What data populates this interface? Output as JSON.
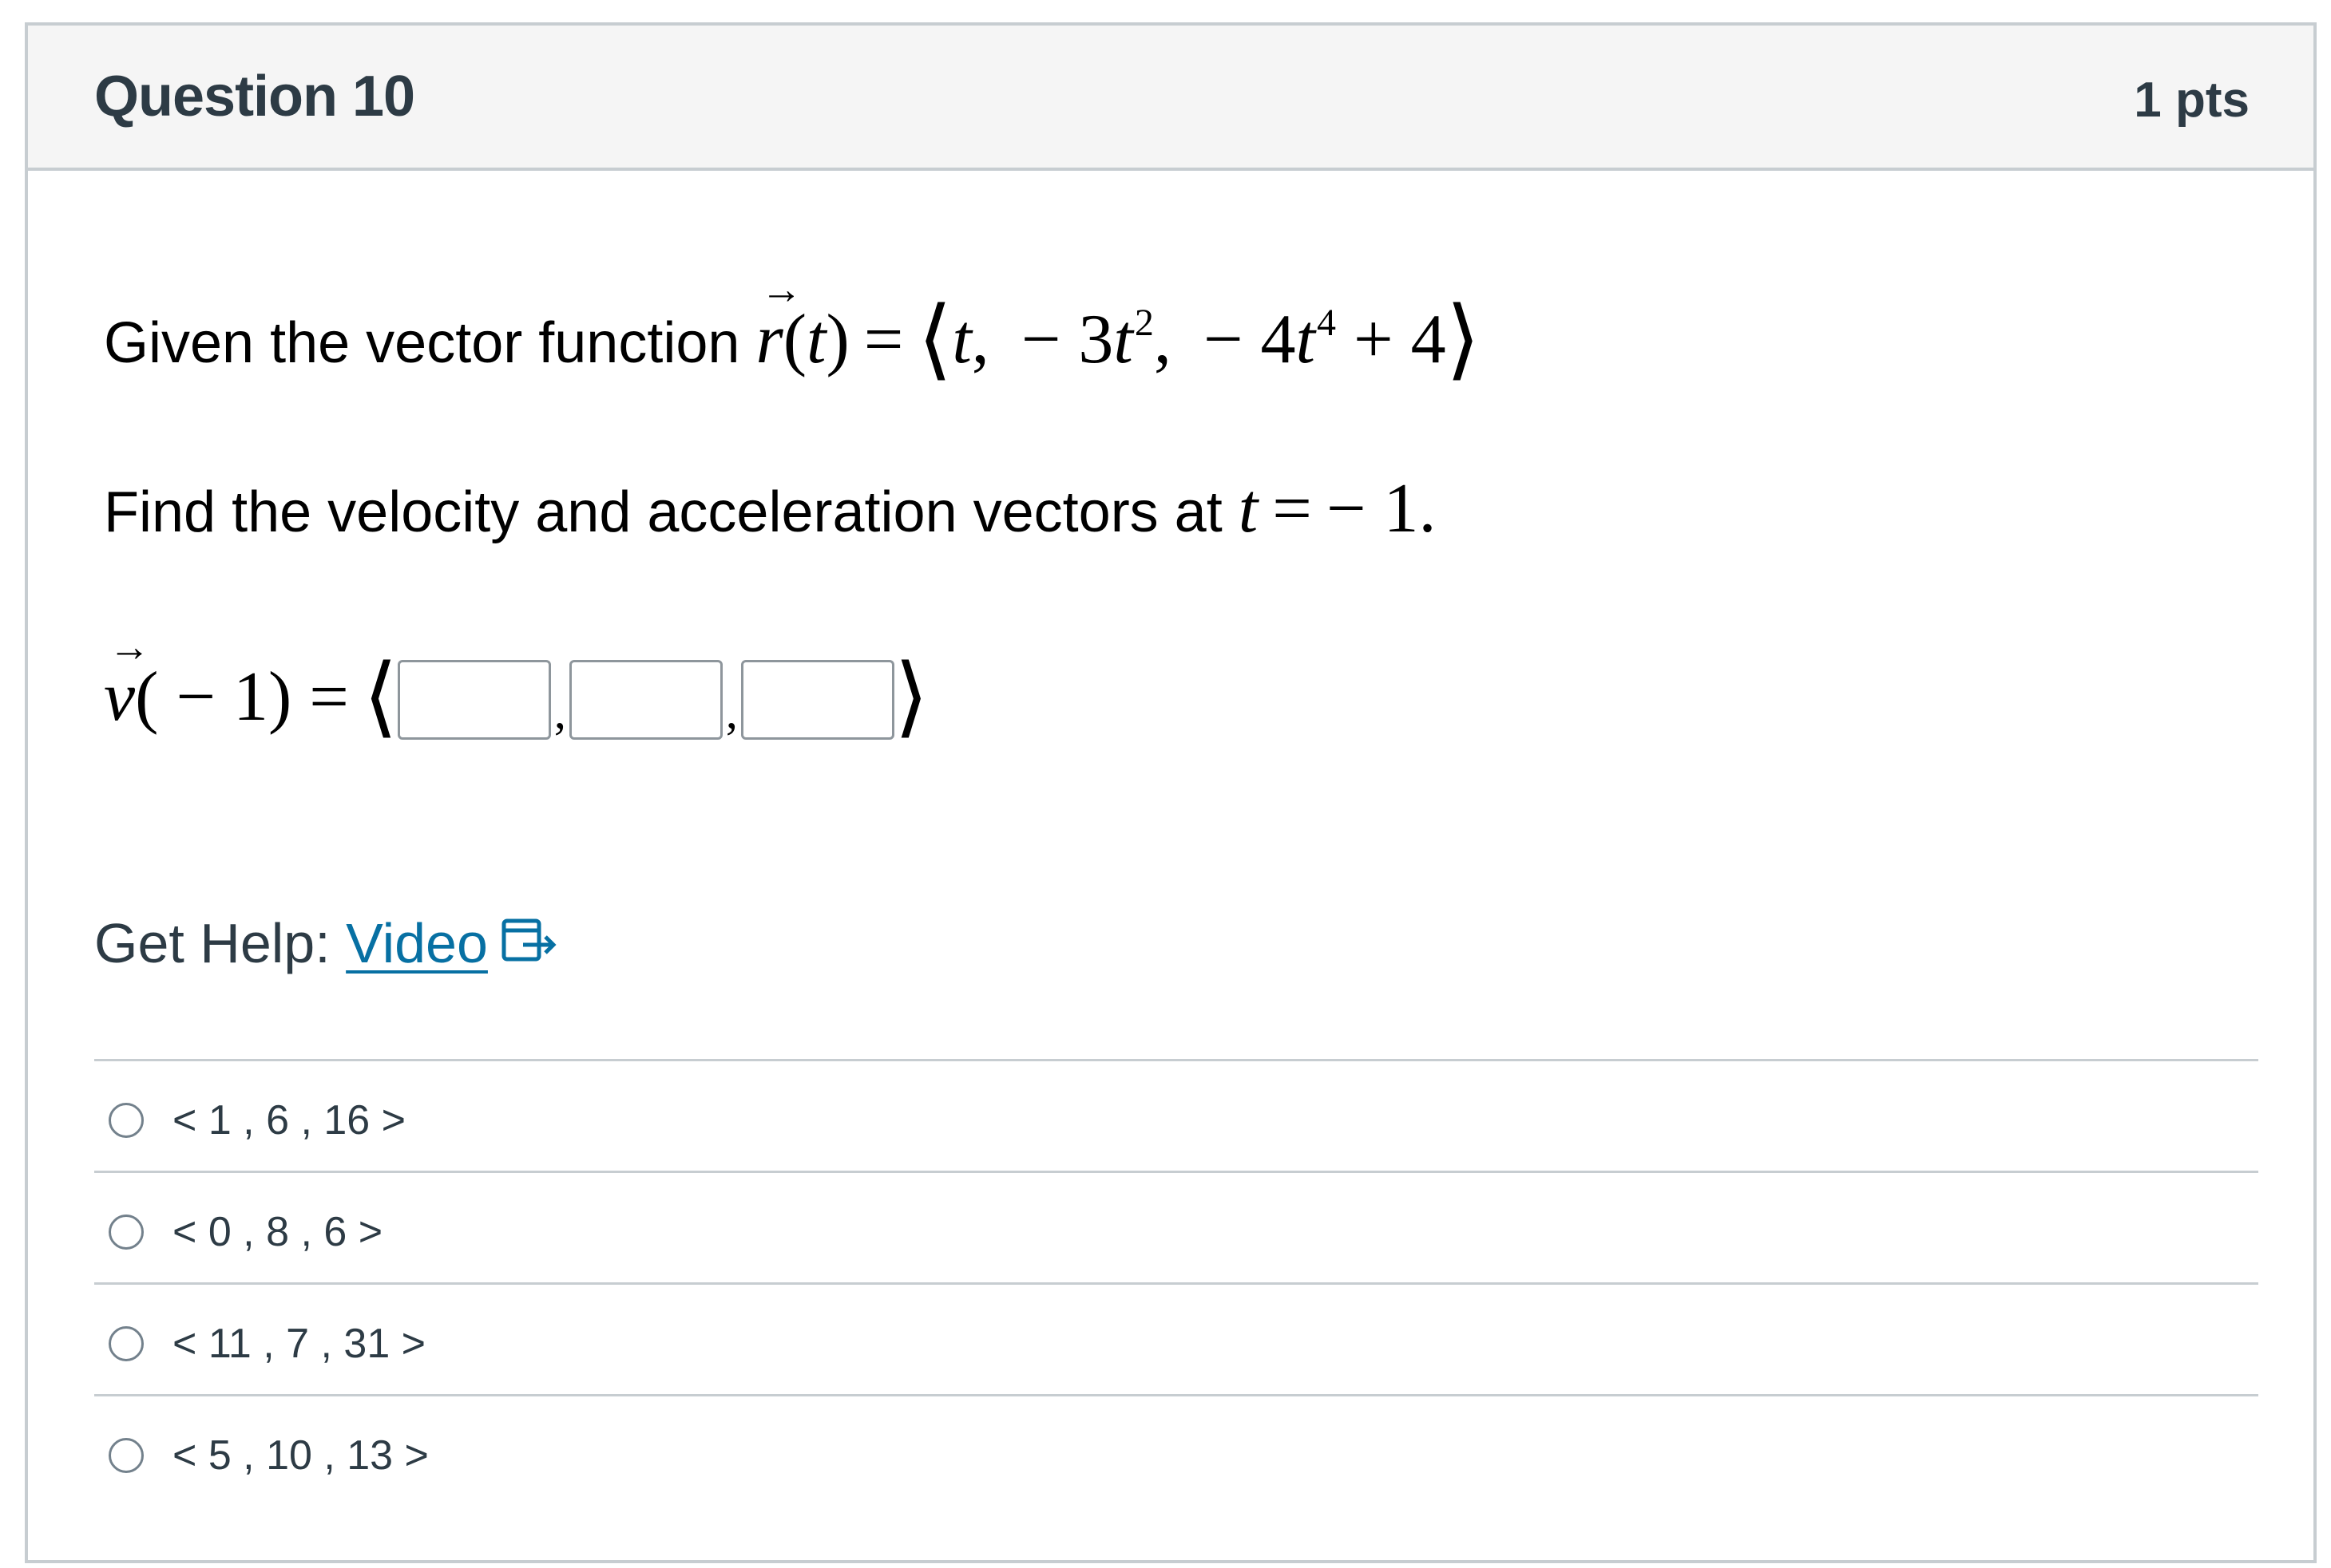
{
  "question": {
    "title": "Question 10",
    "points": "1 pts"
  },
  "prompt": {
    "intro": "Given the vector function ",
    "r_t": "r(t)",
    "equals": "=",
    "components": [
      "t,",
      "− 3t",
      "2",
      ",",
      "− 4t",
      "4",
      "+ 4"
    ],
    "find_text": "Find the velocity and acceleration vectors at ",
    "t_value": "t",
    "t_equals": "=",
    "t_num": "− 1."
  },
  "velocity_row": {
    "v_label": "v",
    "v_arg": "( − 1) =",
    "open_angle": "⟨",
    "close_angle": "⟩",
    "comma": ",",
    "inputs": [
      "",
      "",
      ""
    ]
  },
  "help": {
    "label": "Get Help: ",
    "link_text": "Video",
    "icon": "external-link-icon",
    "link_color": "#0770a3"
  },
  "answers": [
    {
      "label": "< 1 , 6 , 16 >",
      "selected": false
    },
    {
      "label": "< 0 , 8 , 6 >",
      "selected": false
    },
    {
      "label": "< 11 , 7 , 31 >",
      "selected": false
    },
    {
      "label": "< 5 , 10 , 13 >",
      "selected": false
    }
  ]
}
